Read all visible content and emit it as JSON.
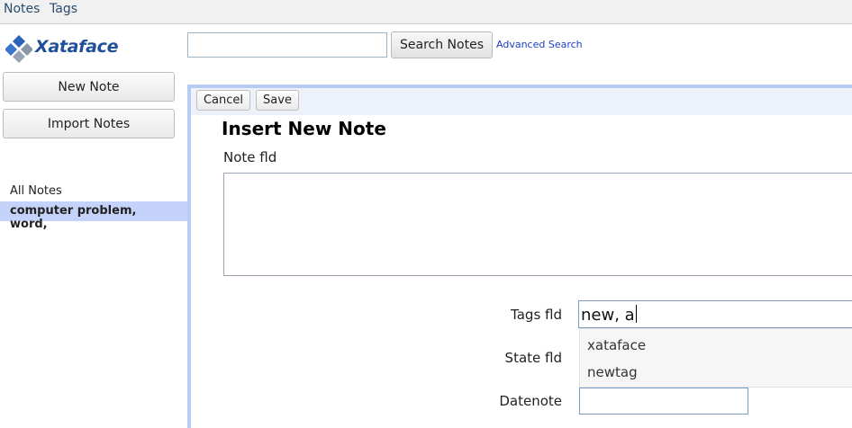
{
  "top_menu": {
    "notes": "Notes",
    "tags": "Tags"
  },
  "logo": {
    "text": "Xataface"
  },
  "search": {
    "value": "",
    "button": "Search Notes",
    "advanced": "Advanced Search"
  },
  "sidebar": {
    "new_note": "New Note",
    "import_notes": "Import Notes",
    "items": [
      {
        "label": "All Notes",
        "selected": false
      },
      {
        "label": "computer problem, word,",
        "selected": true
      }
    ]
  },
  "toolbar": {
    "cancel": "Cancel",
    "save": "Save"
  },
  "form": {
    "title": "Insert New Note",
    "note_label": "Note fld",
    "note_value": "",
    "tags_label": "Tags fld",
    "tags_value": "new, a",
    "state_label": "State fld",
    "date_label": "Datenote",
    "date_value": ""
  },
  "autocomplete": [
    "xataface",
    "newtag"
  ],
  "colors": {
    "selected_bg": "#c5d3fb",
    "panel_border": "#b6ccf2",
    "link": "#1f3ec8",
    "logo": "#1f4f99"
  },
  "icons": {
    "logo_mark": "xataface-diamond-logo-icon"
  }
}
